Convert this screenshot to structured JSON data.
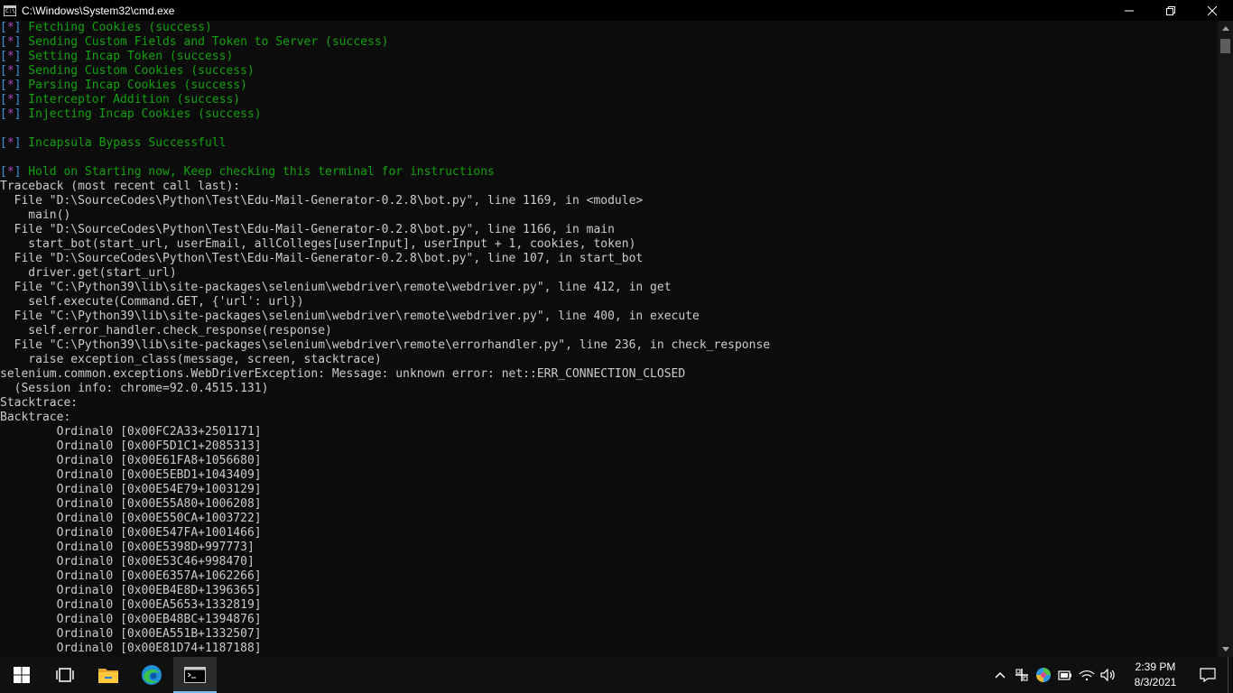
{
  "window": {
    "title": "C:\\Windows\\System32\\cmd.exe",
    "icon_text": "C:\\"
  },
  "console": {
    "status_lines": [
      {
        "open": "[",
        "mark": "*",
        "close": "]",
        "text": " Fetching Cookies (success)"
      },
      {
        "open": "[",
        "mark": "*",
        "close": "]",
        "text": " Sending Custom Fields and Token to Server (success)"
      },
      {
        "open": "[",
        "mark": "*",
        "close": "]",
        "text": " Setting Incap Token (success)"
      },
      {
        "open": "[",
        "mark": "*",
        "close": "]",
        "text": " Sending Custom Cookies (success)"
      },
      {
        "open": "[",
        "mark": "*",
        "close": "]",
        "text": " Parsing Incap Cookies (success)"
      },
      {
        "open": "[",
        "mark": "*",
        "close": "]",
        "text": " Interceptor Addition (success)"
      },
      {
        "open": "[",
        "mark": "*",
        "close": "]",
        "text": " Injecting Incap Cookies (success)"
      }
    ],
    "bypass_line": {
      "open": "[",
      "mark": "*",
      "close": "]",
      "text": " Incapsula Bypass Successfull"
    },
    "hold_line": {
      "open": "[",
      "mark": "*",
      "close": "]",
      "text": " Hold on Starting now, Keep checking this terminal for instructions"
    },
    "traceback_lines": [
      "Traceback (most recent call last):",
      "  File \"D:\\SourceCodes\\Python\\Test\\Edu-Mail-Generator-0.2.8\\bot.py\", line 1169, in <module>",
      "    main()",
      "  File \"D:\\SourceCodes\\Python\\Test\\Edu-Mail-Generator-0.2.8\\bot.py\", line 1166, in main",
      "    start_bot(start_url, userEmail, allColleges[userInput], userInput + 1, cookies, token)",
      "  File \"D:\\SourceCodes\\Python\\Test\\Edu-Mail-Generator-0.2.8\\bot.py\", line 107, in start_bot",
      "    driver.get(start_url)",
      "  File \"C:\\Python39\\lib\\site-packages\\selenium\\webdriver\\remote\\webdriver.py\", line 412, in get",
      "    self.execute(Command.GET, {'url': url})",
      "  File \"C:\\Python39\\lib\\site-packages\\selenium\\webdriver\\remote\\webdriver.py\", line 400, in execute",
      "    self.error_handler.check_response(response)",
      "  File \"C:\\Python39\\lib\\site-packages\\selenium\\webdriver\\remote\\errorhandler.py\", line 236, in check_response",
      "    raise exception_class(message, screen, stacktrace)",
      "selenium.common.exceptions.WebDriverException: Message: unknown error: net::ERR_CONNECTION_CLOSED",
      "  (Session info: chrome=92.0.4515.131)",
      "Stacktrace:",
      "Backtrace:",
      "\tOrdinal0 [0x00FC2A33+2501171]",
      "\tOrdinal0 [0x00F5D1C1+2085313]",
      "\tOrdinal0 [0x00E61FA8+1056680]",
      "\tOrdinal0 [0x00E5EBD1+1043409]",
      "\tOrdinal0 [0x00E54E79+1003129]",
      "\tOrdinal0 [0x00E55A80+1006208]",
      "\tOrdinal0 [0x00E550CA+1003722]",
      "\tOrdinal0 [0x00E547FA+1001466]",
      "\tOrdinal0 [0x00E5398D+997773]",
      "\tOrdinal0 [0x00E53C46+998470]",
      "\tOrdinal0 [0x00E6357A+1062266]",
      "\tOrdinal0 [0x00EB4E8D+1396365]",
      "\tOrdinal0 [0x00EA5653+1332819]",
      "\tOrdinal0 [0x00EB48BC+1394876]",
      "\tOrdinal0 [0x00EA551B+1332507]",
      "\tOrdinal0 [0x00E81D74+1187188]"
    ]
  },
  "taskbar": {
    "items": [
      "start-icon",
      "task-view-icon",
      "file-explorer-icon",
      "edge-icon",
      "cmd-icon"
    ],
    "tray_icons": [
      "chevron-up-icon",
      "network-adapter-icon",
      "colorful-app-icon",
      "battery-icon",
      "wifi-icon",
      "volume-icon"
    ],
    "time": "2:39 PM",
    "date": "8/3/2021"
  },
  "colors": {
    "console_bg": "#0c0c0c",
    "console_text": "#cccccc",
    "bracket": "#3a96dd",
    "star": "#b148c6",
    "success_text": "#13a10e",
    "taskbar_bg": "#101010"
  }
}
